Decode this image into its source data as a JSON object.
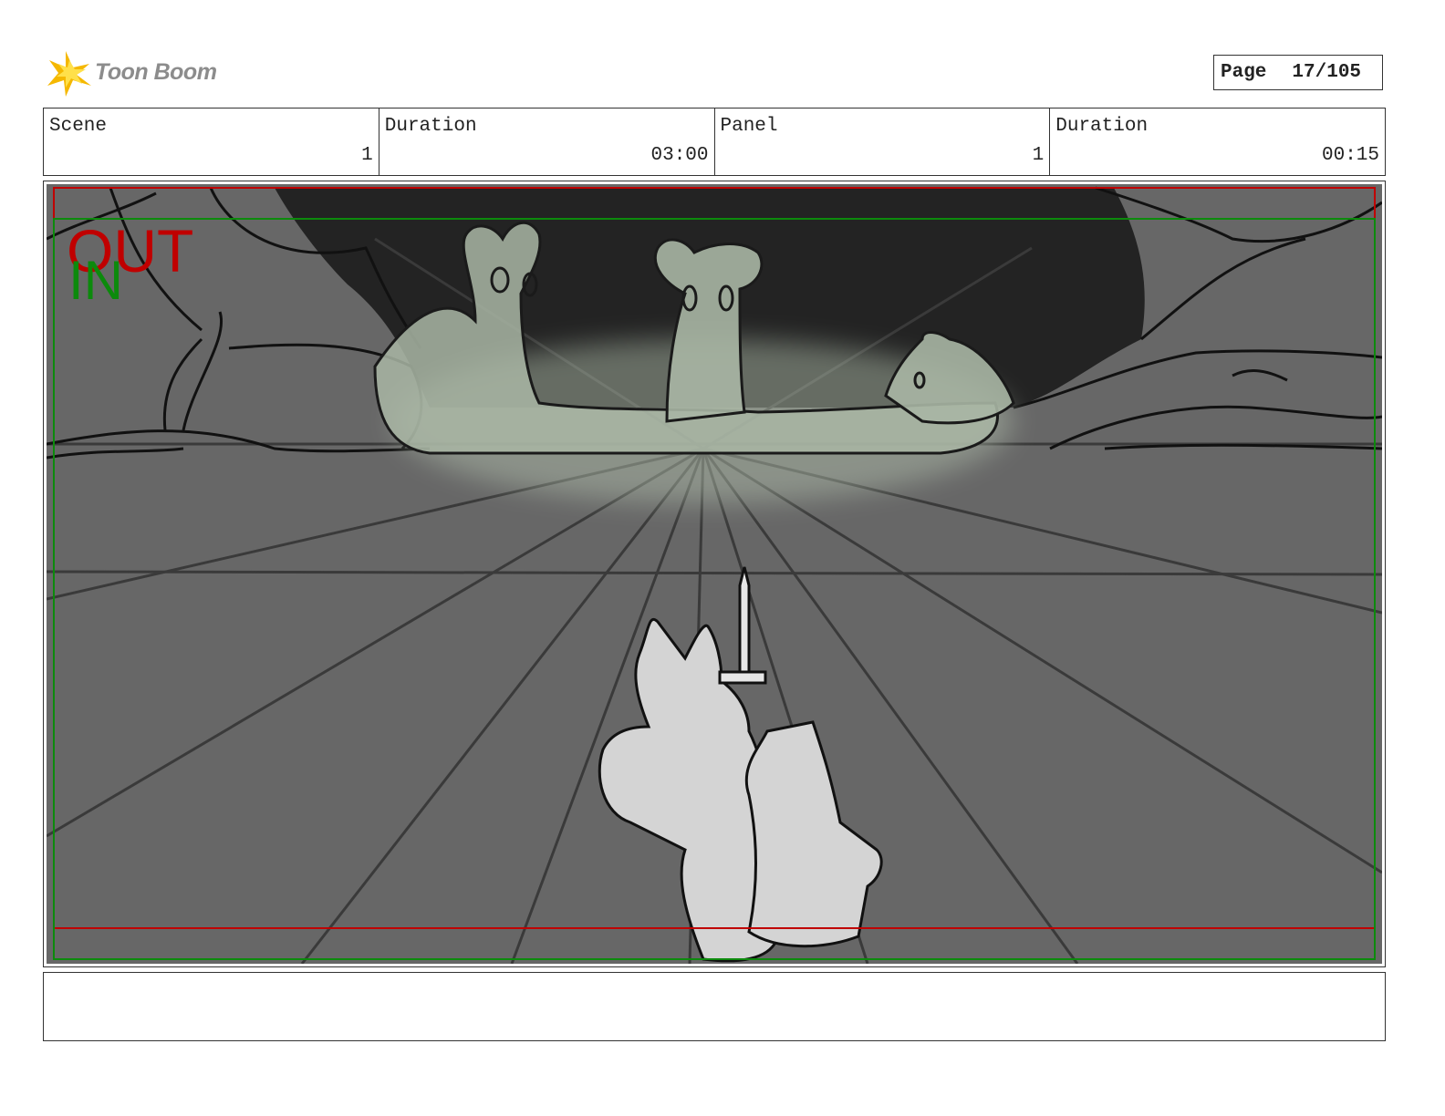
{
  "header": {
    "logo_text": "Toon Boom",
    "page_label": "Page",
    "page_value": "17/105"
  },
  "info": {
    "scene_label": "Scene",
    "scene_value": "1",
    "scene_duration_label": "Duration",
    "scene_duration_value": "03:00",
    "panel_label": "Panel",
    "panel_value": "1",
    "panel_duration_label": "Duration",
    "panel_duration_value": "00:15"
  },
  "panel": {
    "out_label": "OUT",
    "in_label": "IN",
    "colors": {
      "floor": "#676767",
      "cave": "#232323",
      "ghost": "#a9b6a4",
      "hero": "#d4d4d4",
      "out_frame": "#c00000",
      "in_frame": "#0c8a0c"
    }
  },
  "notes": {
    "text": ""
  }
}
